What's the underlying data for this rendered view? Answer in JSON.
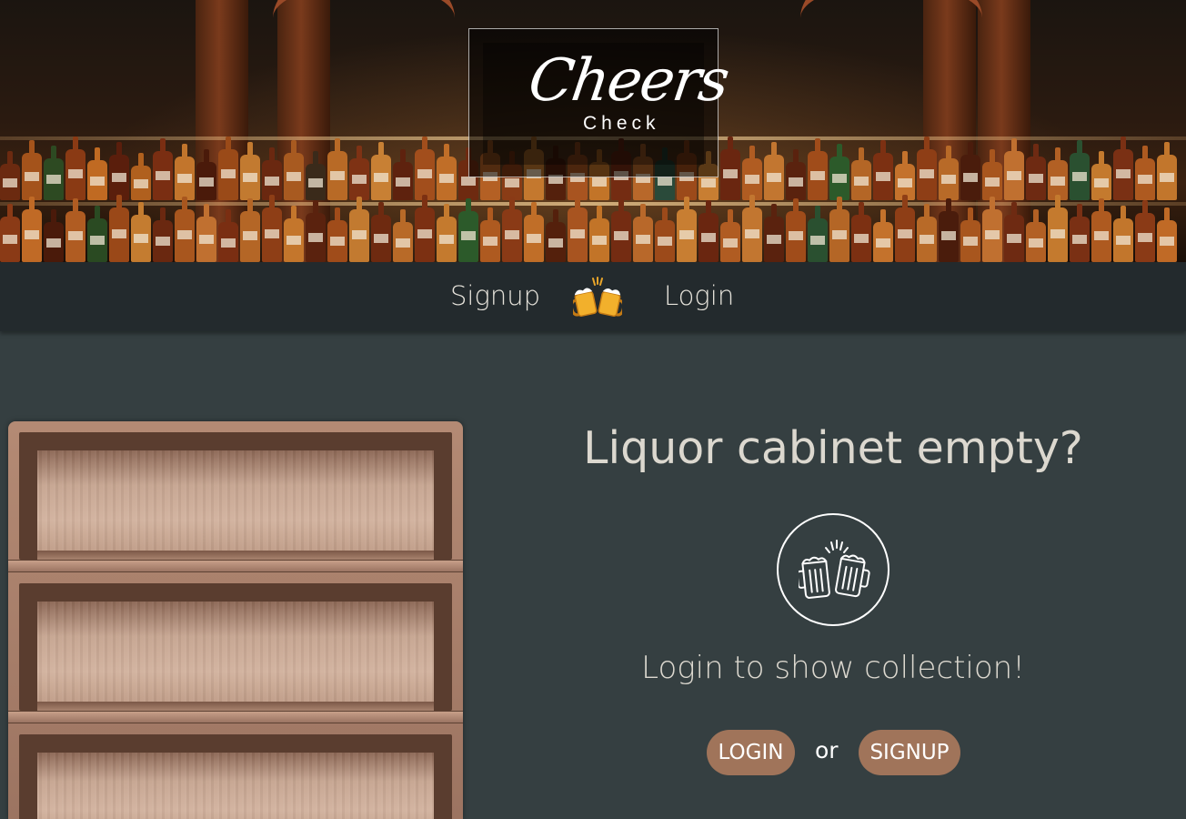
{
  "brand": {
    "logo_script": "Cheers",
    "logo_sub": "Check"
  },
  "nav": {
    "signup_label": "Signup",
    "login_label": "Login",
    "emoji_icon": "clinking-beer-mugs-icon"
  },
  "main": {
    "headline": "Liquor cabinet empty?",
    "icon": "beer-mugs-cheers-icon",
    "subline": "Login to show collection!",
    "login_button": "LOGIN",
    "or_text": "or",
    "signup_button": "SIGNUP"
  },
  "colors": {
    "page_bg": "#353f41",
    "nav_bg": "#232a2d",
    "button_bg": "#a0745a",
    "text": "#dcd8cf"
  }
}
